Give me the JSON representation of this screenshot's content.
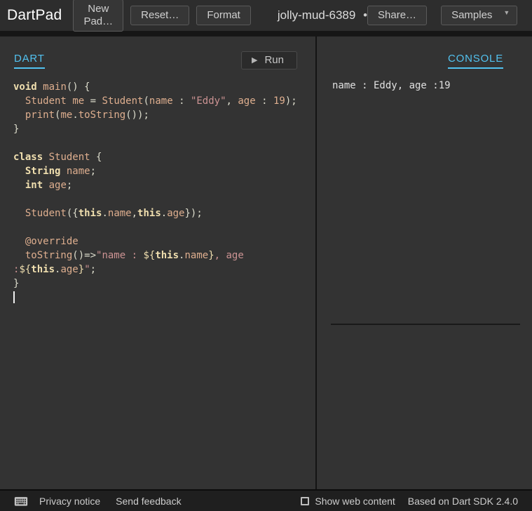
{
  "header": {
    "logo": "DartPad",
    "buttons": {
      "new_pad": "New Pad…",
      "reset": "Reset…",
      "format": "Format",
      "share": "Share…",
      "samples": "Samples"
    },
    "title": "jolly-mud-6389",
    "unsaved_indicator": "•"
  },
  "editor": {
    "tab": "DART",
    "run_label": "Run",
    "code_lines": [
      [
        [
          "kw",
          "void"
        ],
        [
          "pun",
          " "
        ],
        [
          "id",
          "main"
        ],
        [
          "pun",
          "() {"
        ]
      ],
      [
        [
          "pun",
          "  "
        ],
        [
          "id",
          "Student"
        ],
        [
          "pun",
          " "
        ],
        [
          "id",
          "me"
        ],
        [
          "pun",
          " = "
        ],
        [
          "id",
          "Student"
        ],
        [
          "pun",
          "("
        ],
        [
          "id",
          "name"
        ],
        [
          "pun",
          " : "
        ],
        [
          "str",
          "\"Eddy\""
        ],
        [
          "pun",
          ", "
        ],
        [
          "id",
          "age"
        ],
        [
          "pun",
          " : "
        ],
        [
          "num",
          "19"
        ],
        [
          "pun",
          ");"
        ]
      ],
      [
        [
          "pun",
          "  "
        ],
        [
          "id",
          "print"
        ],
        [
          "pun",
          "("
        ],
        [
          "id",
          "me"
        ],
        [
          "pun",
          "."
        ],
        [
          "id",
          "toString"
        ],
        [
          "pun",
          "());"
        ]
      ],
      [
        [
          "pun",
          "}"
        ]
      ],
      [],
      [
        [
          "kw",
          "class"
        ],
        [
          "pun",
          " "
        ],
        [
          "id",
          "Student"
        ],
        [
          "pun",
          " {"
        ]
      ],
      [
        [
          "pun",
          "  "
        ],
        [
          "kw",
          "String"
        ],
        [
          "pun",
          " "
        ],
        [
          "id",
          "name"
        ],
        [
          "pun",
          ";"
        ]
      ],
      [
        [
          "pun",
          "  "
        ],
        [
          "kw",
          "int"
        ],
        [
          "pun",
          " "
        ],
        [
          "id",
          "age"
        ],
        [
          "pun",
          ";"
        ]
      ],
      [],
      [
        [
          "pun",
          "  "
        ],
        [
          "id",
          "Student"
        ],
        [
          "pun",
          "({"
        ],
        [
          "kw",
          "this"
        ],
        [
          "pun",
          "."
        ],
        [
          "id",
          "name"
        ],
        [
          "pun",
          ","
        ],
        [
          "kw",
          "this"
        ],
        [
          "pun",
          "."
        ],
        [
          "id",
          "age"
        ],
        [
          "pun",
          "});"
        ]
      ],
      [],
      [
        [
          "pun",
          "  "
        ],
        [
          "id",
          "@override"
        ]
      ],
      [
        [
          "pun",
          "  "
        ],
        [
          "id",
          "toString"
        ],
        [
          "pun",
          "()=>"
        ],
        [
          "str",
          "\"name : "
        ],
        [
          "interp",
          "${"
        ],
        [
          "kw",
          "this"
        ],
        [
          "pun",
          "."
        ],
        [
          "id",
          "name"
        ],
        [
          "interp",
          "}"
        ],
        [
          "str",
          ", age"
        ]
      ],
      [
        [
          "str",
          ":"
        ],
        [
          "interp",
          "${"
        ],
        [
          "kw",
          "this"
        ],
        [
          "pun",
          "."
        ],
        [
          "id",
          "age"
        ],
        [
          "interp",
          "}"
        ],
        [
          "str",
          "\""
        ],
        [
          "pun",
          ";"
        ]
      ],
      [
        [
          "pun",
          "}"
        ]
      ],
      [
        [
          "cursor",
          ""
        ]
      ]
    ]
  },
  "console": {
    "tab": "CONSOLE",
    "output": "name : Eddy, age :19"
  },
  "footer": {
    "privacy": "Privacy notice",
    "feedback": "Send feedback",
    "show_web_content": "Show web content",
    "sdk": "Based on Dart SDK 2.4.0"
  },
  "colors": {
    "accent_cyan": "#52c2f0",
    "header_bg": "#2d2d2d",
    "panel_bg": "#333333",
    "footer_bg": "#1f1f1f",
    "syntax_keyword": "#f0dfaf",
    "syntax_identifier": "#dfaf8f",
    "syntax_string": "#cc9393",
    "syntax_punctuation": "#dcdccc"
  }
}
